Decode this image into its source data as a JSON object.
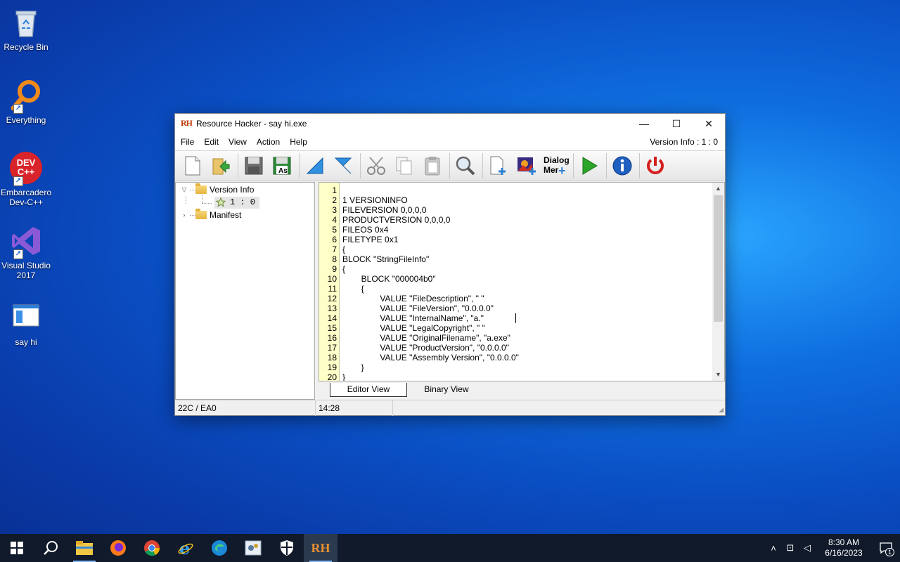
{
  "desktop": {
    "icons": [
      {
        "label": "Recycle Bin"
      },
      {
        "label": "Everything"
      },
      {
        "label": "Embarcadero Dev-C++",
        "logo_text": "DEV C++"
      },
      {
        "label": "Visual Studio 2017"
      },
      {
        "label": "say hi"
      }
    ]
  },
  "window": {
    "logo": "RH",
    "title": "Resource Hacker - say hi.exe",
    "controls": {
      "minimize": "—",
      "maximize": "☐",
      "close": "✕"
    },
    "menu": [
      "File",
      "Edit",
      "View",
      "Action",
      "Help"
    ],
    "resource_label": "Version Info : 1 : 0",
    "toolbar": {
      "icons": [
        "new-file-icon",
        "open-file-icon",
        "save-icon",
        "save-as-icon",
        "back-arrow-icon",
        "forward-arrow-icon",
        "cut-icon",
        "copy-icon",
        "paste-icon",
        "find-icon",
        "add-resource-icon",
        "add-image-icon",
        "dialog-merge-icon",
        "run-script-icon",
        "about-icon",
        "exit-icon"
      ],
      "save_as_text": "As",
      "dialog_text_1": "Dialog",
      "dialog_text_2": "Mer"
    },
    "tree": {
      "version_info": "Version Info",
      "leaf": "1 : 0",
      "manifest": "Manifest"
    },
    "editor": {
      "line_numbers": [
        "1",
        "2",
        "3",
        "4",
        "5",
        "6",
        "7",
        "8",
        "9",
        "10",
        "11",
        "12",
        "13",
        "14",
        "15",
        "16",
        "17",
        "18",
        "19",
        "20"
      ],
      "lines": [
        "",
        "1 VERSIONINFO",
        "FILEVERSION 0,0,0,0",
        "PRODUCTVERSION 0,0,0,0",
        "FILEOS 0x4",
        "FILETYPE 0x1",
        "{",
        "BLOCK \"StringFileInfo\"",
        "{",
        "\tBLOCK \"000004b0\"",
        "\t{",
        "\t\tVALUE \"FileDescription\", \" \"",
        "\t\tVALUE \"FileVersion\", \"0.0.0.0\"",
        "\t\tVALUE \"InternalName\", \"a.\"",
        "\t\tVALUE \"LegalCopyright\", \" \"",
        "\t\tVALUE \"OriginalFilename\", \"a.exe\"",
        "\t\tVALUE \"ProductVersion\", \"0.0.0.0\"",
        "\t\tVALUE \"Assembly Version\", \"0.0.0.0\"",
        "\t}",
        "}"
      ]
    },
    "tabs": {
      "editor": "Editor View",
      "binary": "Binary View"
    },
    "status": {
      "offset": "22C / EA0",
      "position": "14:28"
    }
  },
  "taskbar": {
    "apps": [
      "start-icon",
      "search-icon",
      "file-explorer-icon",
      "firefox-icon",
      "chrome-icon",
      "ie-icon",
      "edge-icon",
      "control-panel-icon",
      "security-icon",
      "resource-hacker-icon"
    ],
    "rh_text": "RH",
    "time": "8:30 AM",
    "date": "6/16/2023",
    "notification_count": "1"
  }
}
